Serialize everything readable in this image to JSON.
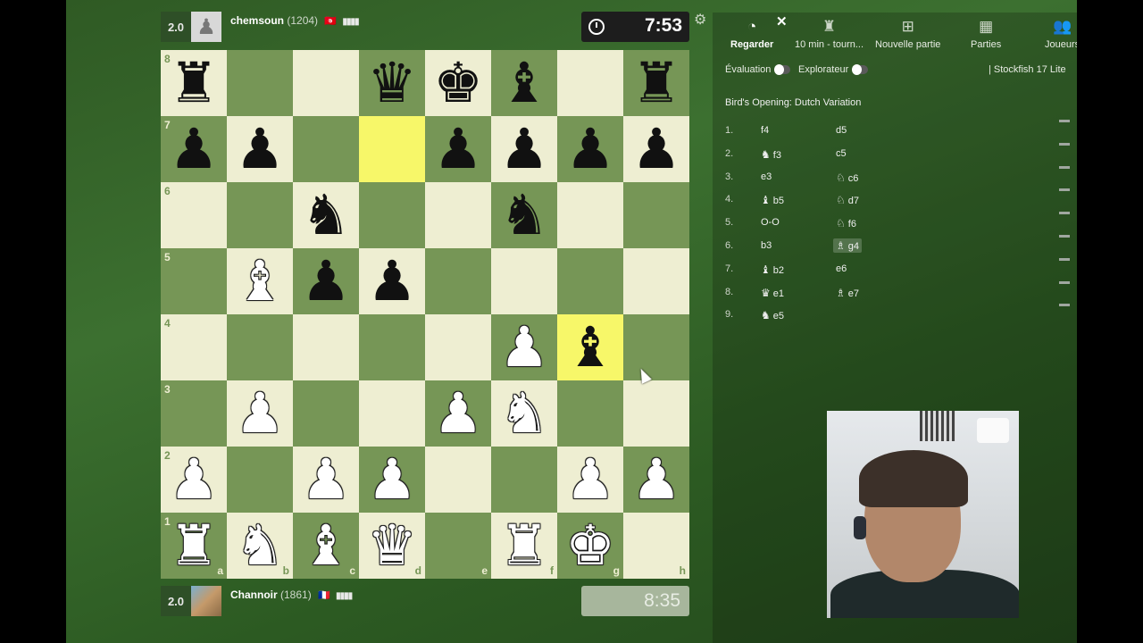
{
  "top_player": {
    "score": "2.0",
    "name": "chemsoun",
    "rating": "(1204)",
    "flag": "🇹🇳",
    "signal": "▮▮▮▮",
    "clock": "7:53"
  },
  "bottom_player": {
    "score": "2.0",
    "name": "Channoir",
    "rating": "(1861)",
    "flag": "🇫🇷",
    "signal": "▮▮▮▮",
    "clock": "8:35"
  },
  "board": {
    "ranks": [
      "8",
      "7",
      "6",
      "5",
      "4",
      "3",
      "2",
      "1"
    ],
    "files": [
      "a",
      "b",
      "c",
      "d",
      "e",
      "f",
      "g",
      "h"
    ],
    "highlight_squares": [
      "d7",
      "g4"
    ],
    "position": {
      "a8": "♜",
      "d8": "♛",
      "e8": "♚",
      "f8": "♝",
      "h8": "♜",
      "a7": "♟",
      "b7": "♟",
      "e7": "♟",
      "f7": "♟",
      "g7": "♟",
      "h7": "♟",
      "c6": "♞",
      "f6": "♞",
      "b5": "♗w",
      "c5": "♟",
      "d5": "♟",
      "f4": "♙w",
      "g4": "♝",
      "b3": "♙w",
      "e3": "♙w",
      "f3": "♘w",
      "a2": "♙w",
      "c2": "♙w",
      "d2": "♙w",
      "g2": "♙w",
      "h2": "♙w",
      "a1": "♖w",
      "b1": "♘w",
      "c1": "♗w",
      "d1": "♕w",
      "f1": "♖w",
      "g1": "♔w"
    }
  },
  "panel": {
    "close": "✕",
    "tabs": [
      {
        "icon": "◔",
        "label": "Regarder"
      },
      {
        "icon": "♜",
        "label": "10 min - tourn..."
      },
      {
        "icon": "⊞",
        "label": "Nouvelle partie"
      },
      {
        "icon": "▦",
        "label": "Parties"
      },
      {
        "icon": "👥",
        "label": "Joueurs"
      }
    ],
    "evaluation_label": "Évaluation",
    "explorer_label": "Explorateur",
    "engine_label": "| Stockfish 17 Lite",
    "opening": "Bird's Opening: Dutch Variation",
    "moves": [
      {
        "num": "1.",
        "white_icon": "",
        "white": "f4",
        "black_icon": "",
        "black": "d5"
      },
      {
        "num": "2.",
        "white_icon": "♞",
        "white": "f3",
        "black_icon": "",
        "black": "c5"
      },
      {
        "num": "3.",
        "white_icon": "",
        "white": "e3",
        "black_icon": "♘",
        "black": "c6"
      },
      {
        "num": "4.",
        "white_icon": "♝",
        "white": "b5",
        "black_icon": "♘",
        "black": "d7"
      },
      {
        "num": "5.",
        "white_icon": "",
        "white": "O-O",
        "black_icon": "♘",
        "black": "f6"
      },
      {
        "num": "6.",
        "white_icon": "",
        "white": "b3",
        "black_icon": "♗",
        "black": "g4"
      },
      {
        "num": "7.",
        "white_icon": "♝",
        "white": "b2",
        "black_icon": "",
        "black": "e6"
      },
      {
        "num": "8.",
        "white_icon": "♛",
        "white": "e1",
        "black_icon": "♗",
        "black": "e7"
      },
      {
        "num": "9.",
        "white_icon": "♞",
        "white": "e5",
        "black_icon": "",
        "black": ""
      }
    ]
  }
}
